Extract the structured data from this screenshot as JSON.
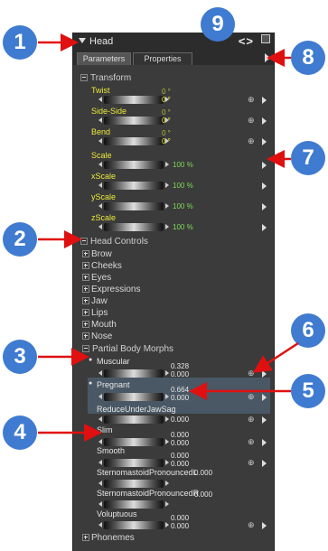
{
  "panel": {
    "title": "Head",
    "nav_arrows": "<>"
  },
  "tabs": [
    "Parameters",
    "Properties"
  ],
  "transform": {
    "label": "Transform",
    "params": [
      {
        "name": "Twist",
        "value": "0 °"
      },
      {
        "name": "Side-Side",
        "value": "0 °"
      },
      {
        "name": "Bend",
        "value": "0 °"
      },
      {
        "name": "Scale",
        "value": "100 %"
      },
      {
        "name": "xScale",
        "value": "100 %"
      },
      {
        "name": "yScale",
        "value": "100 %"
      },
      {
        "name": "zScale",
        "value": "100 %"
      }
    ]
  },
  "head_controls": {
    "label": "Head Controls",
    "items": [
      "Brow",
      "Cheeks",
      "Eyes",
      "Expressions",
      "Jaw",
      "Lips",
      "Mouth",
      "Nose"
    ]
  },
  "partial_body_morphs": {
    "label": "Partial Body Morphs",
    "params": [
      {
        "name": "Muscular",
        "value": "0.328",
        "sub": "0.000"
      },
      {
        "name": "Pregnant",
        "value": "0.664",
        "sub": "0.000"
      },
      {
        "name": "ReduceUnderJawSag",
        "value": "0.000"
      },
      {
        "name": "Slim",
        "value": "0.000",
        "sub": "0.000"
      },
      {
        "name": "Smooth",
        "value": "0.000",
        "sub": "0.000"
      },
      {
        "name": "SternomastoidPronouncedL",
        "value": "0.000"
      },
      {
        "name": "SternomastoidPronouncedR",
        "value": "0.000"
      },
      {
        "name": "Voluptuous",
        "value": "0.000",
        "sub": "0.000"
      }
    ]
  },
  "phonemes": {
    "label": "Phonemes"
  },
  "key_icon": "⊕",
  "callouts": [
    "1",
    "2",
    "3",
    "4",
    "5",
    "6",
    "7",
    "8",
    "9"
  ],
  "colors": {
    "callout": "#3f7bd0",
    "arrow": "#e01010",
    "param_yellow": "#eaea3a",
    "value_green": "#7ed957"
  }
}
